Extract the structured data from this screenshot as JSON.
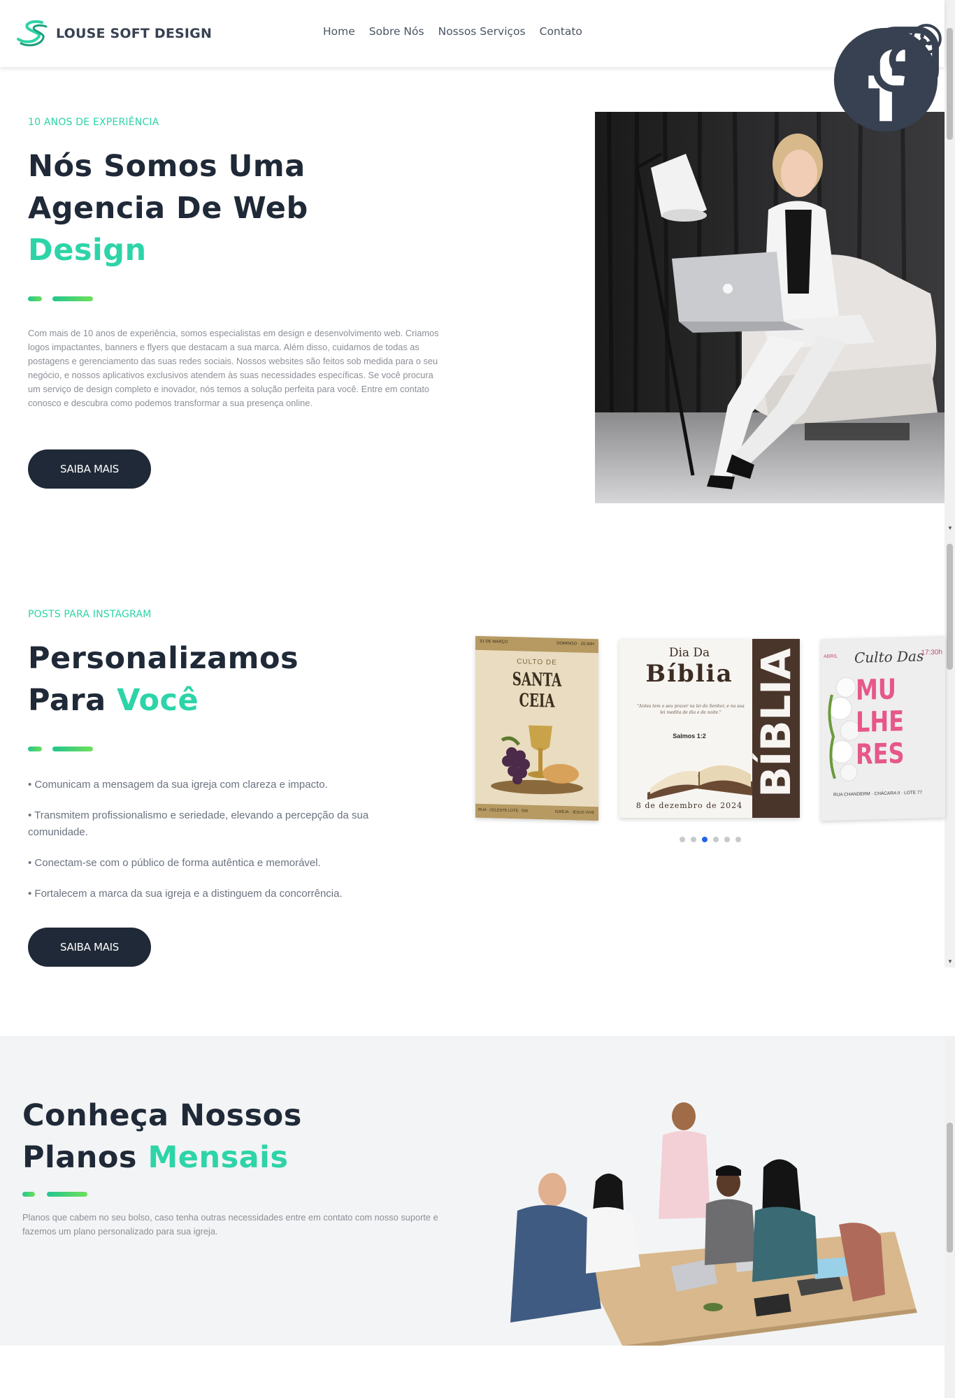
{
  "brand": {
    "name": "LOUSE SOFT DESIGN",
    "accent": "#2dd4a7",
    "dark": "#1f2937"
  },
  "nav": [
    "Home",
    "Sobre Nós",
    "Nossos Serviços",
    "Contato"
  ],
  "social": [
    "facebook-icon",
    "instagram-icon",
    "whatsapp-icon"
  ],
  "hero": {
    "eyebrow": "10 ANOS DE EXPERIÊNCIA",
    "title_line1": "Nós Somos Uma",
    "title_line2": "Agencia De Web",
    "title_accent": "Design",
    "paragraph": "Com mais de 10 anos de experiência, somos especialistas em design e desenvolvimento web. Criamos logos impactantes, banners e flyers que destacam a sua marca. Além disso, cuidamos de todas as postagens e gerenciamento das suas redes sociais. Nossos websites são feitos sob medida para o seu negócio, e nossos aplicativos exclusivos atendem às suas necessidades específicas. Se você procura um serviço de design completo e inovador, nós temos a solução perfeita para você. Entre em contato conosco e descubra como podemos transformar a sua presença online.",
    "button": "SAIBA MAIS"
  },
  "instagram": {
    "eyebrow": "POSTS PARA INSTAGRAM",
    "title_line1": "Personalizamos",
    "title_line2_plain": "Para ",
    "title_accent": "Você",
    "bullets": [
      "• Comunicam a mensagem da sua igreja com clareza e impacto.",
      "• Transmitem profissionalismo e seriedade, elevando a percepção da sua comunidade.",
      "• Conectam-se com o público de forma autêntica e memorável.",
      "• Fortalecem a marca da sua igreja e a distinguem da concorrência."
    ],
    "button": "SAIBA MAIS",
    "cards": {
      "card1": {
        "top_left": "31 DE MARÇO",
        "top_right": "DOMINGO · 20:30H",
        "sub": "CULTO DE",
        "title": "SANTA CEIA",
        "bottom_left": "RUA · CELESTE LOTE · 550",
        "bottom_right": "IGREJA · JESUS VIVE"
      },
      "card2": {
        "pre": "Dia Da",
        "title": "Bíblia",
        "quote": "\"Antes tem o seu prazer na lei do Senhor, e na sua lei medita de dia e de noite.\"",
        "ref": "Salmos 1:2",
        "date": "8 de dezembro de 2024",
        "vertical": "BÍBLIA"
      },
      "card3": {
        "month": "ABRIL",
        "title": "Culto Das",
        "time": "17:30h",
        "big1": "MU",
        "big2": "LHE",
        "big3": "RES",
        "address": "RUA CHANDERM · CHÁCARA II · LOTE 77"
      }
    },
    "dots_total": 6,
    "dots_active": 3
  },
  "plans": {
    "title_line1": "Conheça Nossos",
    "title_line2_plain": "Planos ",
    "title_accent": "Mensais",
    "paragraph": "Planos que cabem no seu bolso, caso tenha outras necessidades entre em contato com nosso suporte e fazemos um plano personalizado para sua igreja."
  }
}
